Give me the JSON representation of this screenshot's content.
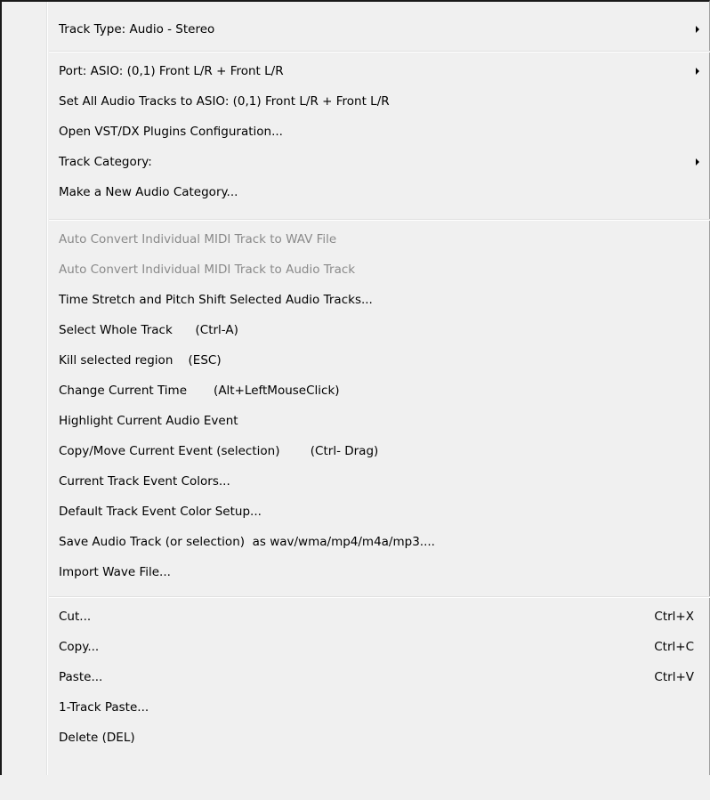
{
  "menu": {
    "items": [
      {
        "label": "Track Type: Audio - Stereo",
        "submenu": true
      },
      {
        "label": "Port: ASIO: (0,1) Front L/R + Front L/R",
        "submenu": true
      },
      {
        "label": "Set All Audio Tracks to ASIO: (0,1) Front L/R + Front L/R"
      },
      {
        "label": "Open VST/DX Plugins Configuration..."
      },
      {
        "label": "Track Category:",
        "submenu": true
      },
      {
        "label": "Make a New Audio Category..."
      },
      {
        "label": "Auto Convert Individual MIDI Track to WAV File",
        "disabled": true
      },
      {
        "label": "Auto Convert Individual MIDI Track to Audio Track",
        "disabled": true
      },
      {
        "label": "Time Stretch and Pitch Shift Selected Audio Tracks..."
      },
      {
        "label": "Select Whole Track      (Ctrl-A)"
      },
      {
        "label": "Kill selected region    (ESC)"
      },
      {
        "label": "Change Current Time       (Alt+LeftMouseClick)"
      },
      {
        "label": "Highlight Current Audio Event"
      },
      {
        "label": "Copy/Move Current Event (selection)        (Ctrl- Drag)"
      },
      {
        "label": "Current Track Event Colors..."
      },
      {
        "label": "Default Track Event Color Setup..."
      },
      {
        "label": "Save Audio Track (or selection)  as wav/wma/mp4/m4a/mp3...."
      },
      {
        "label": "Import Wave File..."
      },
      {
        "label": "Cut...",
        "shortcut": "Ctrl+X"
      },
      {
        "label": "Copy...",
        "shortcut": "Ctrl+C"
      },
      {
        "label": "Paste...",
        "shortcut": "Ctrl+V"
      },
      {
        "label": "1-Track Paste..."
      },
      {
        "label": "Delete (DEL)"
      }
    ]
  }
}
